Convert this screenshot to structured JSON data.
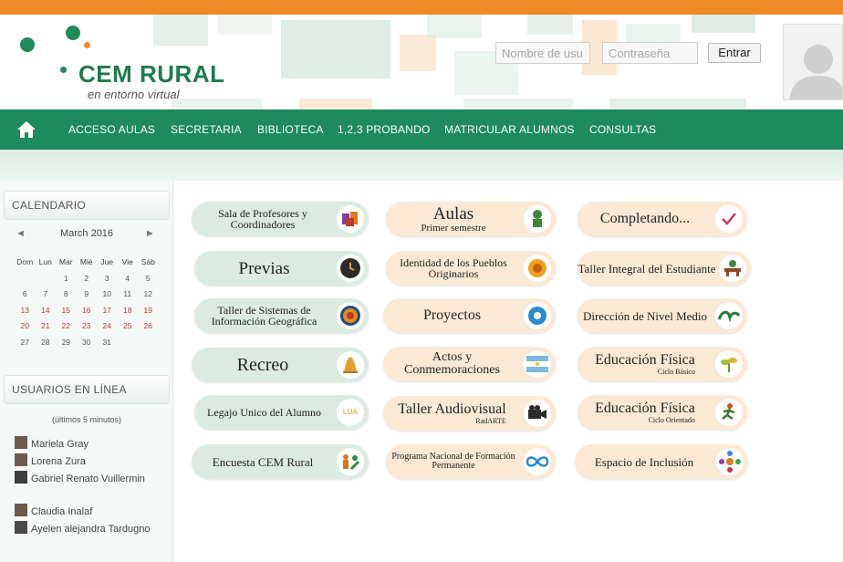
{
  "header": {
    "logo_title": "CEM RURAL",
    "logo_subtitle": "en entorno virtual",
    "username_placeholder": "Nombre de usu",
    "password_placeholder": "Contraseña",
    "enter_button": "Entrar"
  },
  "nav": {
    "items": [
      "ACCESO AULAS",
      "SECRETARIA",
      "BIBLIOTECA",
      "1,2,3 PROBANDO",
      "MATRICULAR ALUMNOS",
      "CONSULTAS"
    ]
  },
  "calendar": {
    "heading": "CALENDARIO",
    "month": "March 2016",
    "weekdays": [
      "Dom",
      "Lun",
      "Mar",
      "Mié",
      "Jue",
      "Vie",
      "Sáb"
    ],
    "weeks": [
      [
        "",
        "",
        "1",
        "2",
        "3",
        "4",
        "5"
      ],
      [
        "6",
        "7",
        "8",
        "9",
        "10",
        "11",
        "12"
      ],
      [
        "13",
        "14",
        "15",
        "16",
        "17",
        "18",
        "19"
      ],
      [
        "20",
        "21",
        "22",
        "23",
        "24",
        "25",
        "26"
      ],
      [
        "27",
        "28",
        "29",
        "30",
        "31",
        "",
        ""
      ]
    ]
  },
  "online": {
    "heading": "USUARIOS EN LÍNEA",
    "note": "(últimos 5 minutos)",
    "users": [
      "Mariela Gray",
      "Lorena Zura",
      "Gabriel Renato Vuillermin",
      "Claudia Inalaf",
      "Ayelen alejandra Tardugno"
    ]
  },
  "tiles": {
    "col1": [
      {
        "label": "Sala de Profesores y Coordinadores",
        "icon": "folders-icon"
      },
      {
        "label": "Previas",
        "icon": "clock-icon"
      },
      {
        "label": "Taller de Sistemas de Información Geográfica",
        "icon": "target-icon"
      },
      {
        "label": "Recreo",
        "icon": "bell-icon"
      },
      {
        "label": "Legajo Unico del Alumno",
        "icon": "badge-icon",
        "badge": "LUA"
      },
      {
        "label": "Encuesta CEM Rural",
        "icon": "people-icon"
      }
    ],
    "col2": [
      {
        "label": "Aulas",
        "sub": "Primer semestre",
        "icon": "student-icon"
      },
      {
        "label": "Identidad de los Pueblos Originarios",
        "icon": "sun-icon"
      },
      {
        "label": "Proyectos",
        "icon": "gear-icon"
      },
      {
        "label": "Actos y Conmemoraciones",
        "icon": "flag-icon"
      },
      {
        "label": "Taller Audiovisual",
        "sub": "RadARTE",
        "icon": "camera-icon"
      },
      {
        "label": "Programa Nacional de Formación Permanente",
        "icon": "infinity-icon"
      }
    ],
    "col3": [
      {
        "label": "Completando...",
        "icon": "checkmark-icon"
      },
      {
        "label": "Taller Integral del Estudiante",
        "icon": "desk-icon"
      },
      {
        "label": "Dirección de Nivel Medio",
        "icon": "logo-icon"
      },
      {
        "label": "Educación Física",
        "sub": "Ciclo Básico",
        "icon": "plant-icon"
      },
      {
        "label": "Educación Física",
        "sub": "Ciclo Orientado",
        "icon": "runner-icon"
      },
      {
        "label": "Espacio de Inclusión",
        "icon": "network-icon"
      }
    ]
  },
  "colors": {
    "orange": "#f08a24",
    "nav_green": "#1d8a5f",
    "tile_green": "#dcebe1",
    "tile_peach": "#fbe9d6"
  }
}
